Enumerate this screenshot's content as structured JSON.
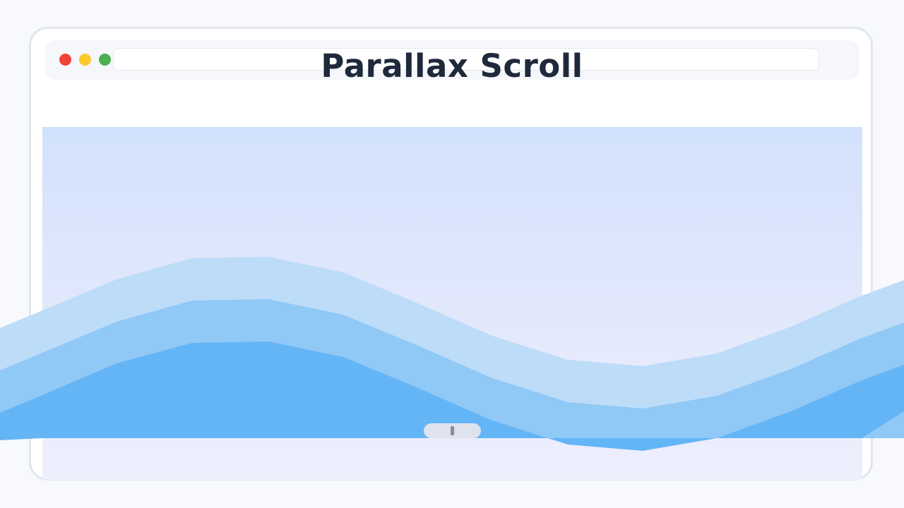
{
  "page": {
    "title": "Parallax Scroll"
  },
  "window_controls": [
    {
      "name": "close",
      "color": "#f04438"
    },
    {
      "name": "minimize",
      "color": "#f9c92e"
    },
    {
      "name": "maximize",
      "color": "#4caf50"
    }
  ],
  "colors": {
    "sky_top": "#d2e1fc",
    "sky_bottom": "#eeeffd",
    "wave_back": "#bcdcf8",
    "wave_mid": "#90c8f6",
    "wave_front": "#64b5f6",
    "title": "#1e293b"
  },
  "layers": [
    {
      "name": "back-wave"
    },
    {
      "name": "mid-wave"
    },
    {
      "name": "front-wave"
    }
  ],
  "scroll_indicator": {
    "icon": "scroll-grip-icon"
  }
}
